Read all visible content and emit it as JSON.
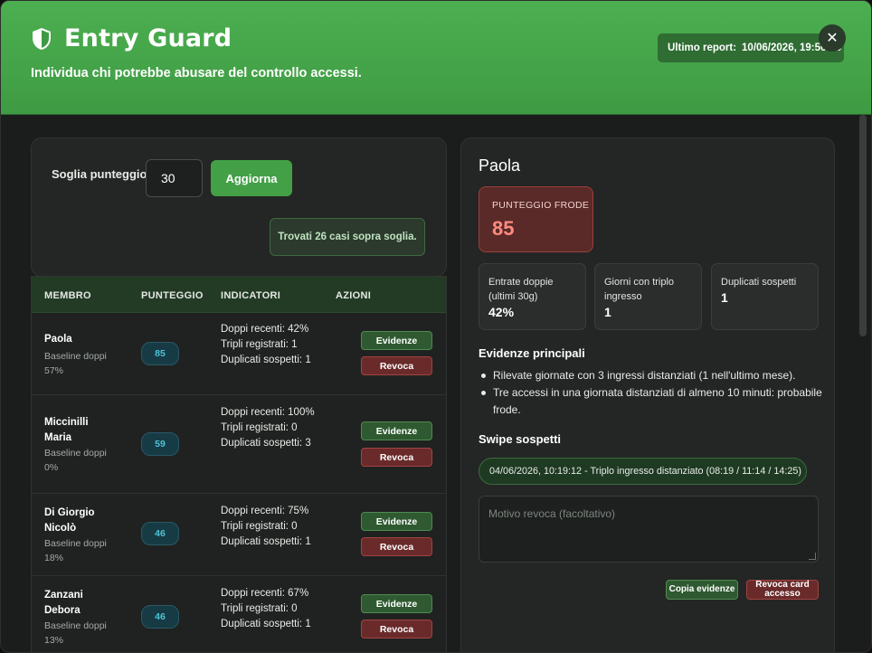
{
  "header": {
    "title": "Entry Guard",
    "subtitle": "Individua chi potrebbe abusare del controllo accessi.",
    "report_label": "Ultimo report:",
    "report_value": "10/06/2026, 19:56:58",
    "close_glyph": "✕",
    "shield_icon": "shield-check-icon"
  },
  "filter": {
    "threshold_label": "Soglia punteggio",
    "threshold_value": "30",
    "update_label": "Aggiorna",
    "found_text": "Trovati 26 casi sopra soglia."
  },
  "table": {
    "columns": [
      "MEMBRO",
      "PUNTEGGIO",
      "INDICATORI",
      "AZIONI"
    ],
    "evidence_label": "Evidenze",
    "revoke_label": "Revoca",
    "rows": [
      {
        "name": "Paola",
        "baseline": "Baseline doppi 57%",
        "score": "85",
        "indicators": "Doppi recenti: 42% Tripli registrati: 1 Duplicati sospetti: 1"
      },
      {
        "name": "Miccinilli Maria",
        "baseline": "Baseline doppi 0%",
        "score": "59",
        "indicators": "Doppi recenti: 100% Tripli registrati: 0 Duplicati sospetti: 3"
      },
      {
        "name": "Di Giorgio Nicolò",
        "baseline": "Baseline doppi 18%",
        "score": "46",
        "indicators": "Doppi recenti: 75% Tripli registrati: 0 Duplicati sospetti: 1"
      },
      {
        "name": "Zanzani Debora",
        "baseline": "Baseline doppi 13%",
        "score": "46",
        "indicators": "Doppi recenti: 67% Tripli registrati: 0 Duplicati sospetti: 1"
      }
    ]
  },
  "detail": {
    "name": "Paola",
    "fraud_label": "PUNTEGGIO FRODE",
    "fraud_value": "85",
    "stats": [
      {
        "label": "Entrate doppie (ultimi 30g)",
        "value": "42%"
      },
      {
        "label": "Giorni con triplo ingresso",
        "value": "1"
      },
      {
        "label": "Duplicati sospetti",
        "value": "1"
      }
    ],
    "evidence_title": "Evidenze principali",
    "evidence": [
      "Rilevate giornate con 3 ingressi distanziati (1 nell'ultimo mese).",
      "Tre accessi in una giornata distanziati di almeno 10 minuti: probabile frode."
    ],
    "swipe_title": "Swipe sospetti",
    "swipe_item": "04/06/2026, 10:19:12 - Triplo ingresso distanziato (08:19 / 11:14 / 14:25)",
    "reason_placeholder": "Motivo revoca (facoltativo)",
    "copy_label": "Copia evidenze",
    "revoke_card_label": "Revoca card accesso"
  },
  "colors": {
    "header_green": "#4caf50",
    "accent_green": "#43a047",
    "danger_red": "#a14343",
    "score_cyan": "#4dc3d6",
    "fraud_text": "#ff8a80"
  }
}
